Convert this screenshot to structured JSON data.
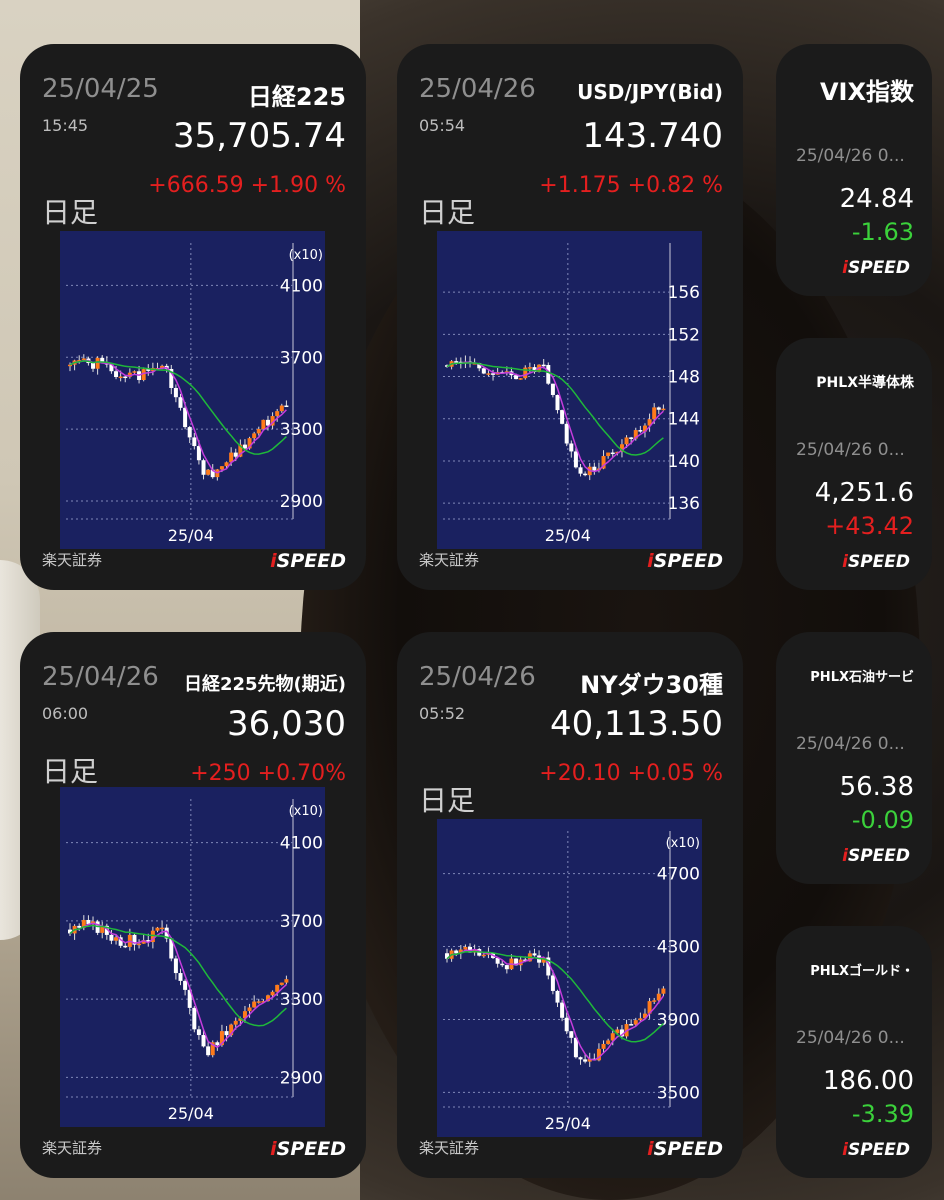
{
  "widgets": {
    "nikkei": {
      "date": "25/04/25",
      "time": "15:45",
      "name": "日経225",
      "price": "35,705.74",
      "change": "+666.59 +1.90 %",
      "period": "日足",
      "scale_note": "(x10)",
      "y_ticks": [
        "4100",
        "3700",
        "3300",
        "2900"
      ],
      "x_label": "25/04",
      "provider": "楽天証券"
    },
    "usdjpy": {
      "date": "25/04/26",
      "time": "05:54",
      "name": "USD/JPY(Bid)",
      "price": "143.740",
      "change": "+1.175 +0.82 %",
      "period": "日足",
      "y_ticks": [
        "156",
        "152",
        "148",
        "144",
        "140",
        "136"
      ],
      "x_label": "25/04",
      "provider": "楽天証券"
    },
    "nikkei_futures": {
      "date": "25/04/26",
      "time": "06:00",
      "name": "日経225先物(期近)",
      "price": "36,030",
      "change": "+250 +0.70%",
      "period": "日足",
      "scale_note": "(x10)",
      "y_ticks": [
        "4100",
        "3700",
        "3300",
        "2900"
      ],
      "x_label": "25/04",
      "provider": "楽天証券"
    },
    "dow": {
      "date": "25/04/26",
      "time": "05:52",
      "name": "NYダウ30種",
      "price": "40,113.50",
      "change": "+20.10 +0.05 %",
      "period": "日足",
      "scale_note": "(x10)",
      "y_ticks": [
        "4700",
        "4300",
        "3900",
        "3500"
      ],
      "x_label": "25/04",
      "provider": "楽天証券"
    }
  },
  "small_widgets": {
    "vix": {
      "name": "VIX指数",
      "date": "25/04/26 0...",
      "price": "24.84",
      "change": "-1.63",
      "direction": "down"
    },
    "sox": {
      "name": "PHLX半導体株",
      "date": "25/04/26 0...",
      "price": "4,251.6",
      "change": "+43.42",
      "direction": "up"
    },
    "oil": {
      "name": "PHLX石油サービ",
      "date": "25/04/26 0...",
      "price": "56.38",
      "change": "-0.09",
      "direction": "down"
    },
    "gold": {
      "name": "PHLXゴールド・",
      "date": "25/04/26 0...",
      "price": "186.00",
      "change": "-3.39",
      "direction": "down"
    }
  },
  "brand": {
    "logo_i": "i",
    "logo_rest": "SPEED"
  },
  "colors": {
    "up": "#e41f1f",
    "down": "#3bd13b",
    "chart_bg": "#1a2160",
    "ma_short": "#c43cdc",
    "ma_long": "#1fb83a"
  }
}
